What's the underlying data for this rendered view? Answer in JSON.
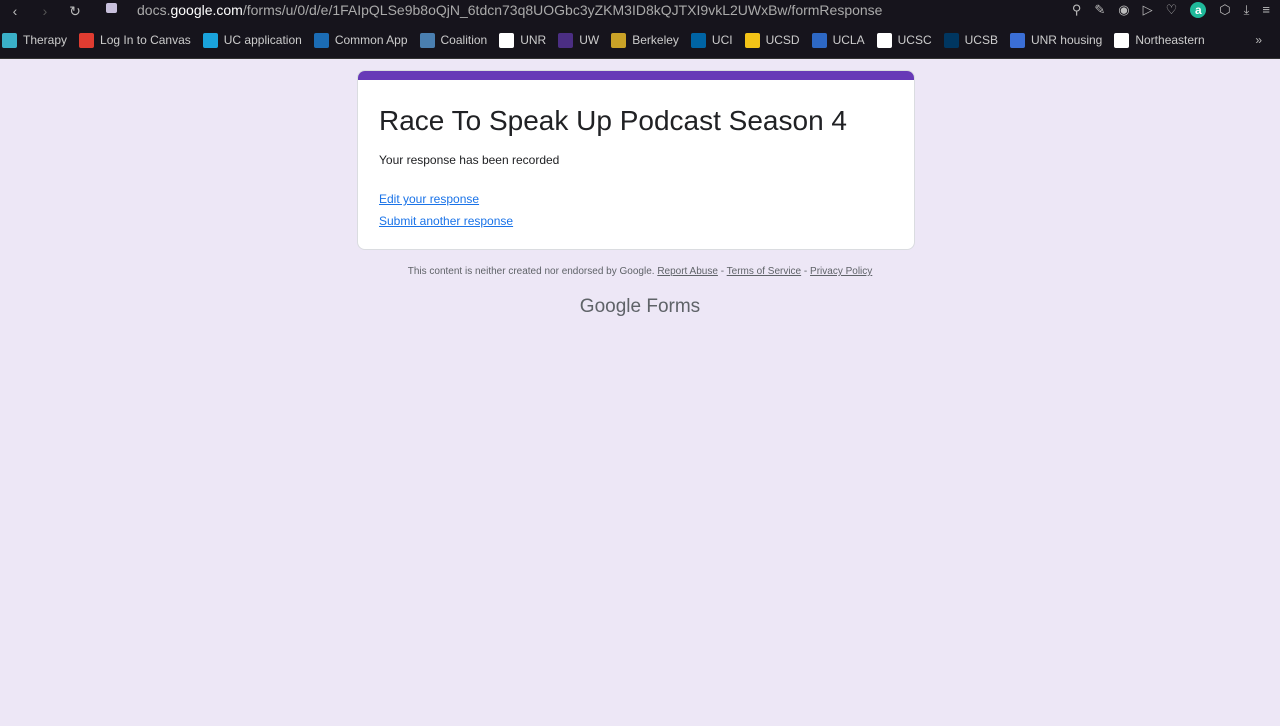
{
  "browser": {
    "url_host": "docs.google.com",
    "url_prefix": "docs.",
    "url_domain": "google.com",
    "url_path": "/forms/u/0/d/e/1FAIpQLSe9b8oQjN_6tdcn73q8UOGbc3yZKM3ID8kQJTXI9vkL2UWxBw/formResponse",
    "account_initial": "a"
  },
  "bookmarks": [
    {
      "label": "Therapy",
      "color": "#3ab0c8"
    },
    {
      "label": "Log In to Canvas",
      "color": "#e03c31"
    },
    {
      "label": "UC application",
      "color": "#1aa3dc"
    },
    {
      "label": "Common App",
      "color": "#1b6cb5"
    },
    {
      "label": "Coalition",
      "color": "#4a7fb0"
    },
    {
      "label": "UNR",
      "color": "#ffffff"
    },
    {
      "label": "UW",
      "color": "#4b2e83"
    },
    {
      "label": "Berkeley",
      "color": "#c9a227"
    },
    {
      "label": "UCI",
      "color": "#0064a4"
    },
    {
      "label": "UCSD",
      "color": "#f3c317"
    },
    {
      "label": "UCLA",
      "color": "#2d68c4"
    },
    {
      "label": "UCSC",
      "color": "#ffffff"
    },
    {
      "label": "UCSB",
      "color": "#003660"
    },
    {
      "label": "UNR housing",
      "color": "#3b6fd6"
    },
    {
      "label": "Northeastern",
      "color": "#ffffff"
    }
  ],
  "form": {
    "title": "Race To Speak Up Podcast Season 4",
    "message": "Your response has been recorded",
    "edit_link": "Edit your response",
    "submit_another_link": "Submit another response",
    "accent": "#673ab7"
  },
  "footer": {
    "disclaimer": "This content is neither created nor endorsed by Google.",
    "report_abuse": "Report Abuse",
    "terms": "Terms of Service",
    "privacy": "Privacy Policy",
    "sep": "-",
    "logo_google": "Google",
    "logo_forms": "Forms"
  }
}
